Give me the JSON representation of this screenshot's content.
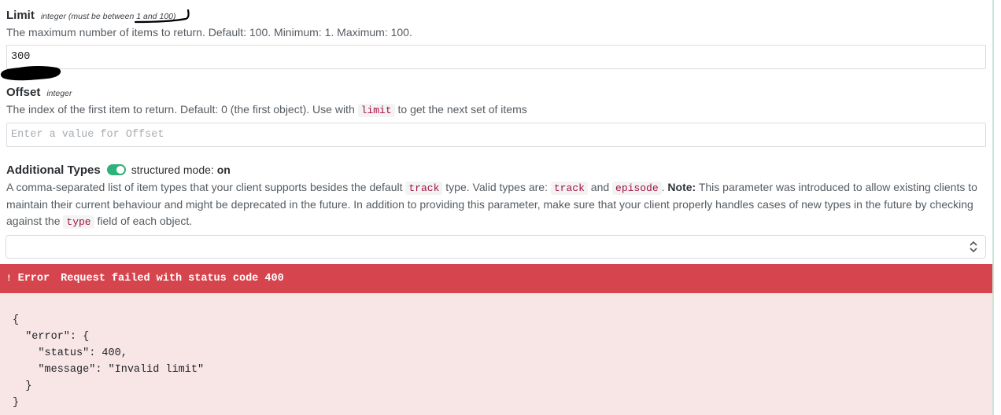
{
  "params": {
    "limit": {
      "name": "Limit",
      "type_note": "integer (must be between 1 and 100)",
      "description": "The maximum number of items to return. Default: 100. Minimum: 1. Maximum: 100.",
      "value": "300",
      "placeholder": ""
    },
    "offset": {
      "name": "Offset",
      "type_note": "integer",
      "desc_before": "The index of the first item to return. Default: 0 (the first object). Use with",
      "desc_code": "limit",
      "desc_after": "to get the next set of items",
      "value": "",
      "placeholder": "Enter a value for Offset"
    },
    "additional_types": {
      "name": "Additional Types",
      "toggle_state": "on",
      "structured_label": "structured mode:",
      "structured_value": "on",
      "desc_1": "A comma-separated list of item types that your client supports besides the default",
      "code_track": "track",
      "desc_2": "type. Valid types are:",
      "code_track_2": "track",
      "desc_and": "and",
      "code_episode": "episode",
      "desc_note_label": "Note:",
      "desc_3": "This parameter was introduced to allow existing clients to maintain their current behaviour and might be deprecated in the future. In addition to providing this parameter, make sure that your client properly handles cases of new types in the future by checking against the",
      "code_type": "type",
      "desc_4": "field of each object.",
      "selected_value": ""
    }
  },
  "error": {
    "icon": "!",
    "label": "Error",
    "message": "Request failed with status code 400",
    "body": "{\n  \"error\": {\n    \"status\": 400,\n    \"message\": \"Invalid limit\"\n  }\n}"
  },
  "colors": {
    "error_bar": "#d6454d",
    "error_body": "#f8e5e6",
    "toggle_on": "#2fb27a",
    "code_text": "#a3123f"
  }
}
